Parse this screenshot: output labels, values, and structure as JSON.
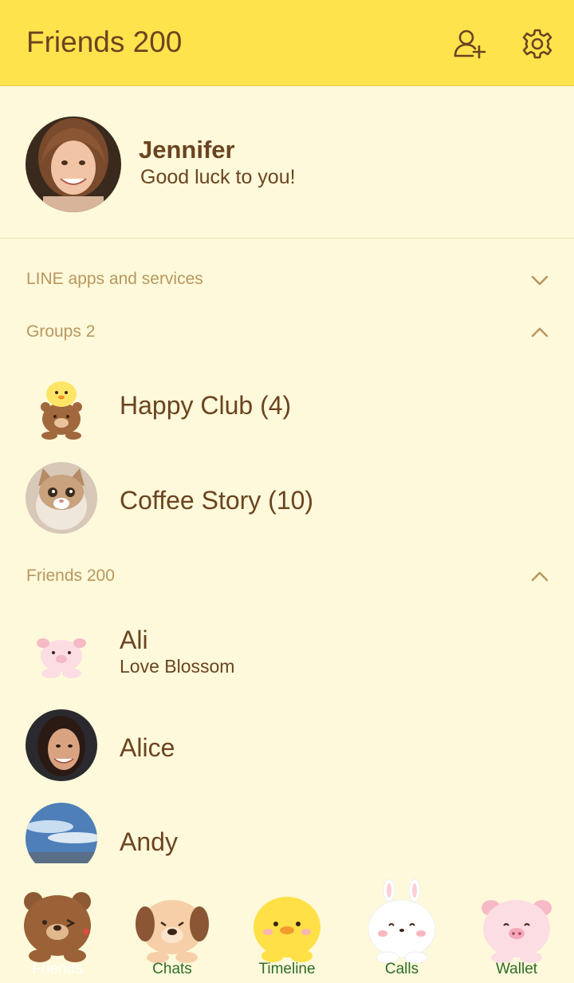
{
  "header": {
    "title": "Friends 200",
    "add_friend_icon": "add-friend-icon",
    "settings_icon": "gear-icon"
  },
  "profile": {
    "name": "Jennifer",
    "status": "Good luck to you!"
  },
  "sections": {
    "services": {
      "label": "LINE apps and services",
      "state": "collapsed"
    },
    "groups": {
      "label": "Groups 2",
      "state": "expanded"
    },
    "friends": {
      "label": "Friends 200",
      "state": "expanded"
    }
  },
  "groups": [
    {
      "name": "Happy Club (4)"
    },
    {
      "name": "Coffee Story (10)"
    }
  ],
  "friends": [
    {
      "name": "Ali",
      "status": "Love Blossom"
    },
    {
      "name": "Alice",
      "status": ""
    },
    {
      "name": "Andy",
      "status": ""
    }
  ],
  "tabs": [
    {
      "label": "Friends",
      "icon": "bear-icon",
      "active": true
    },
    {
      "label": "Chats",
      "icon": "puppy-icon",
      "active": false
    },
    {
      "label": "Timeline",
      "icon": "chick-icon",
      "active": false
    },
    {
      "label": "Calls",
      "icon": "bunny-icon",
      "active": false
    },
    {
      "label": "Wallet",
      "icon": "pig-icon",
      "active": false
    }
  ],
  "colors": {
    "header_bg": "#FFE34D",
    "page_bg": "#FEF9DA",
    "text": "#6B4420",
    "section_text": "#B9975F",
    "tab_text": "#2E6B2A"
  }
}
